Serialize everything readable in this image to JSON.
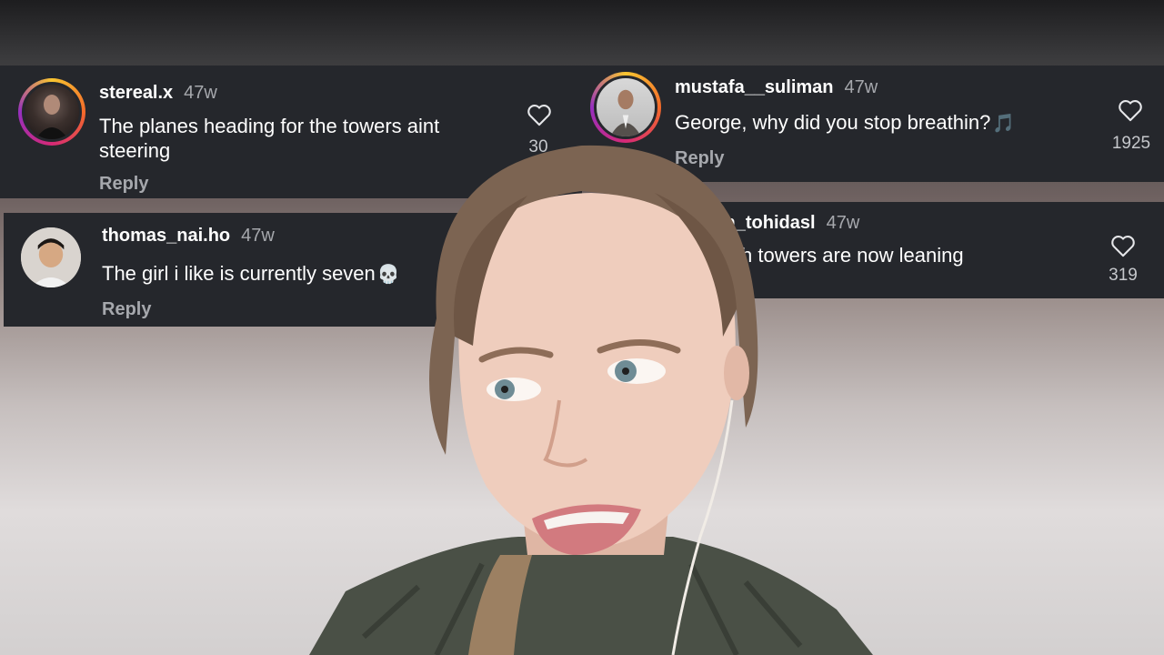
{
  "comments": [
    {
      "username": "stereal.x",
      "age": "47w",
      "text": "The planes heading for the towers aint steering",
      "reply": "Reply",
      "likes": "30"
    },
    {
      "username": "mustafa__suliman",
      "age": "47w",
      "text": "George, why did you stop breathin?",
      "emoji": "🎵",
      "reply": "Reply",
      "likes": "1925"
    },
    {
      "username": "thomas_nai.ho",
      "age": "47w",
      "text": "The girl i like is currently seven",
      "emoji": "💀",
      "reply": "Reply"
    },
    {
      "username": "in_tohidasl",
      "age": "47w",
      "text": "h towers are now leaning",
      "likes": "319"
    }
  ],
  "icons": {
    "like": "heart-outline-icon"
  },
  "colors": {
    "card_bg": "#25272c",
    "meta_text": "#a6a8ad"
  }
}
